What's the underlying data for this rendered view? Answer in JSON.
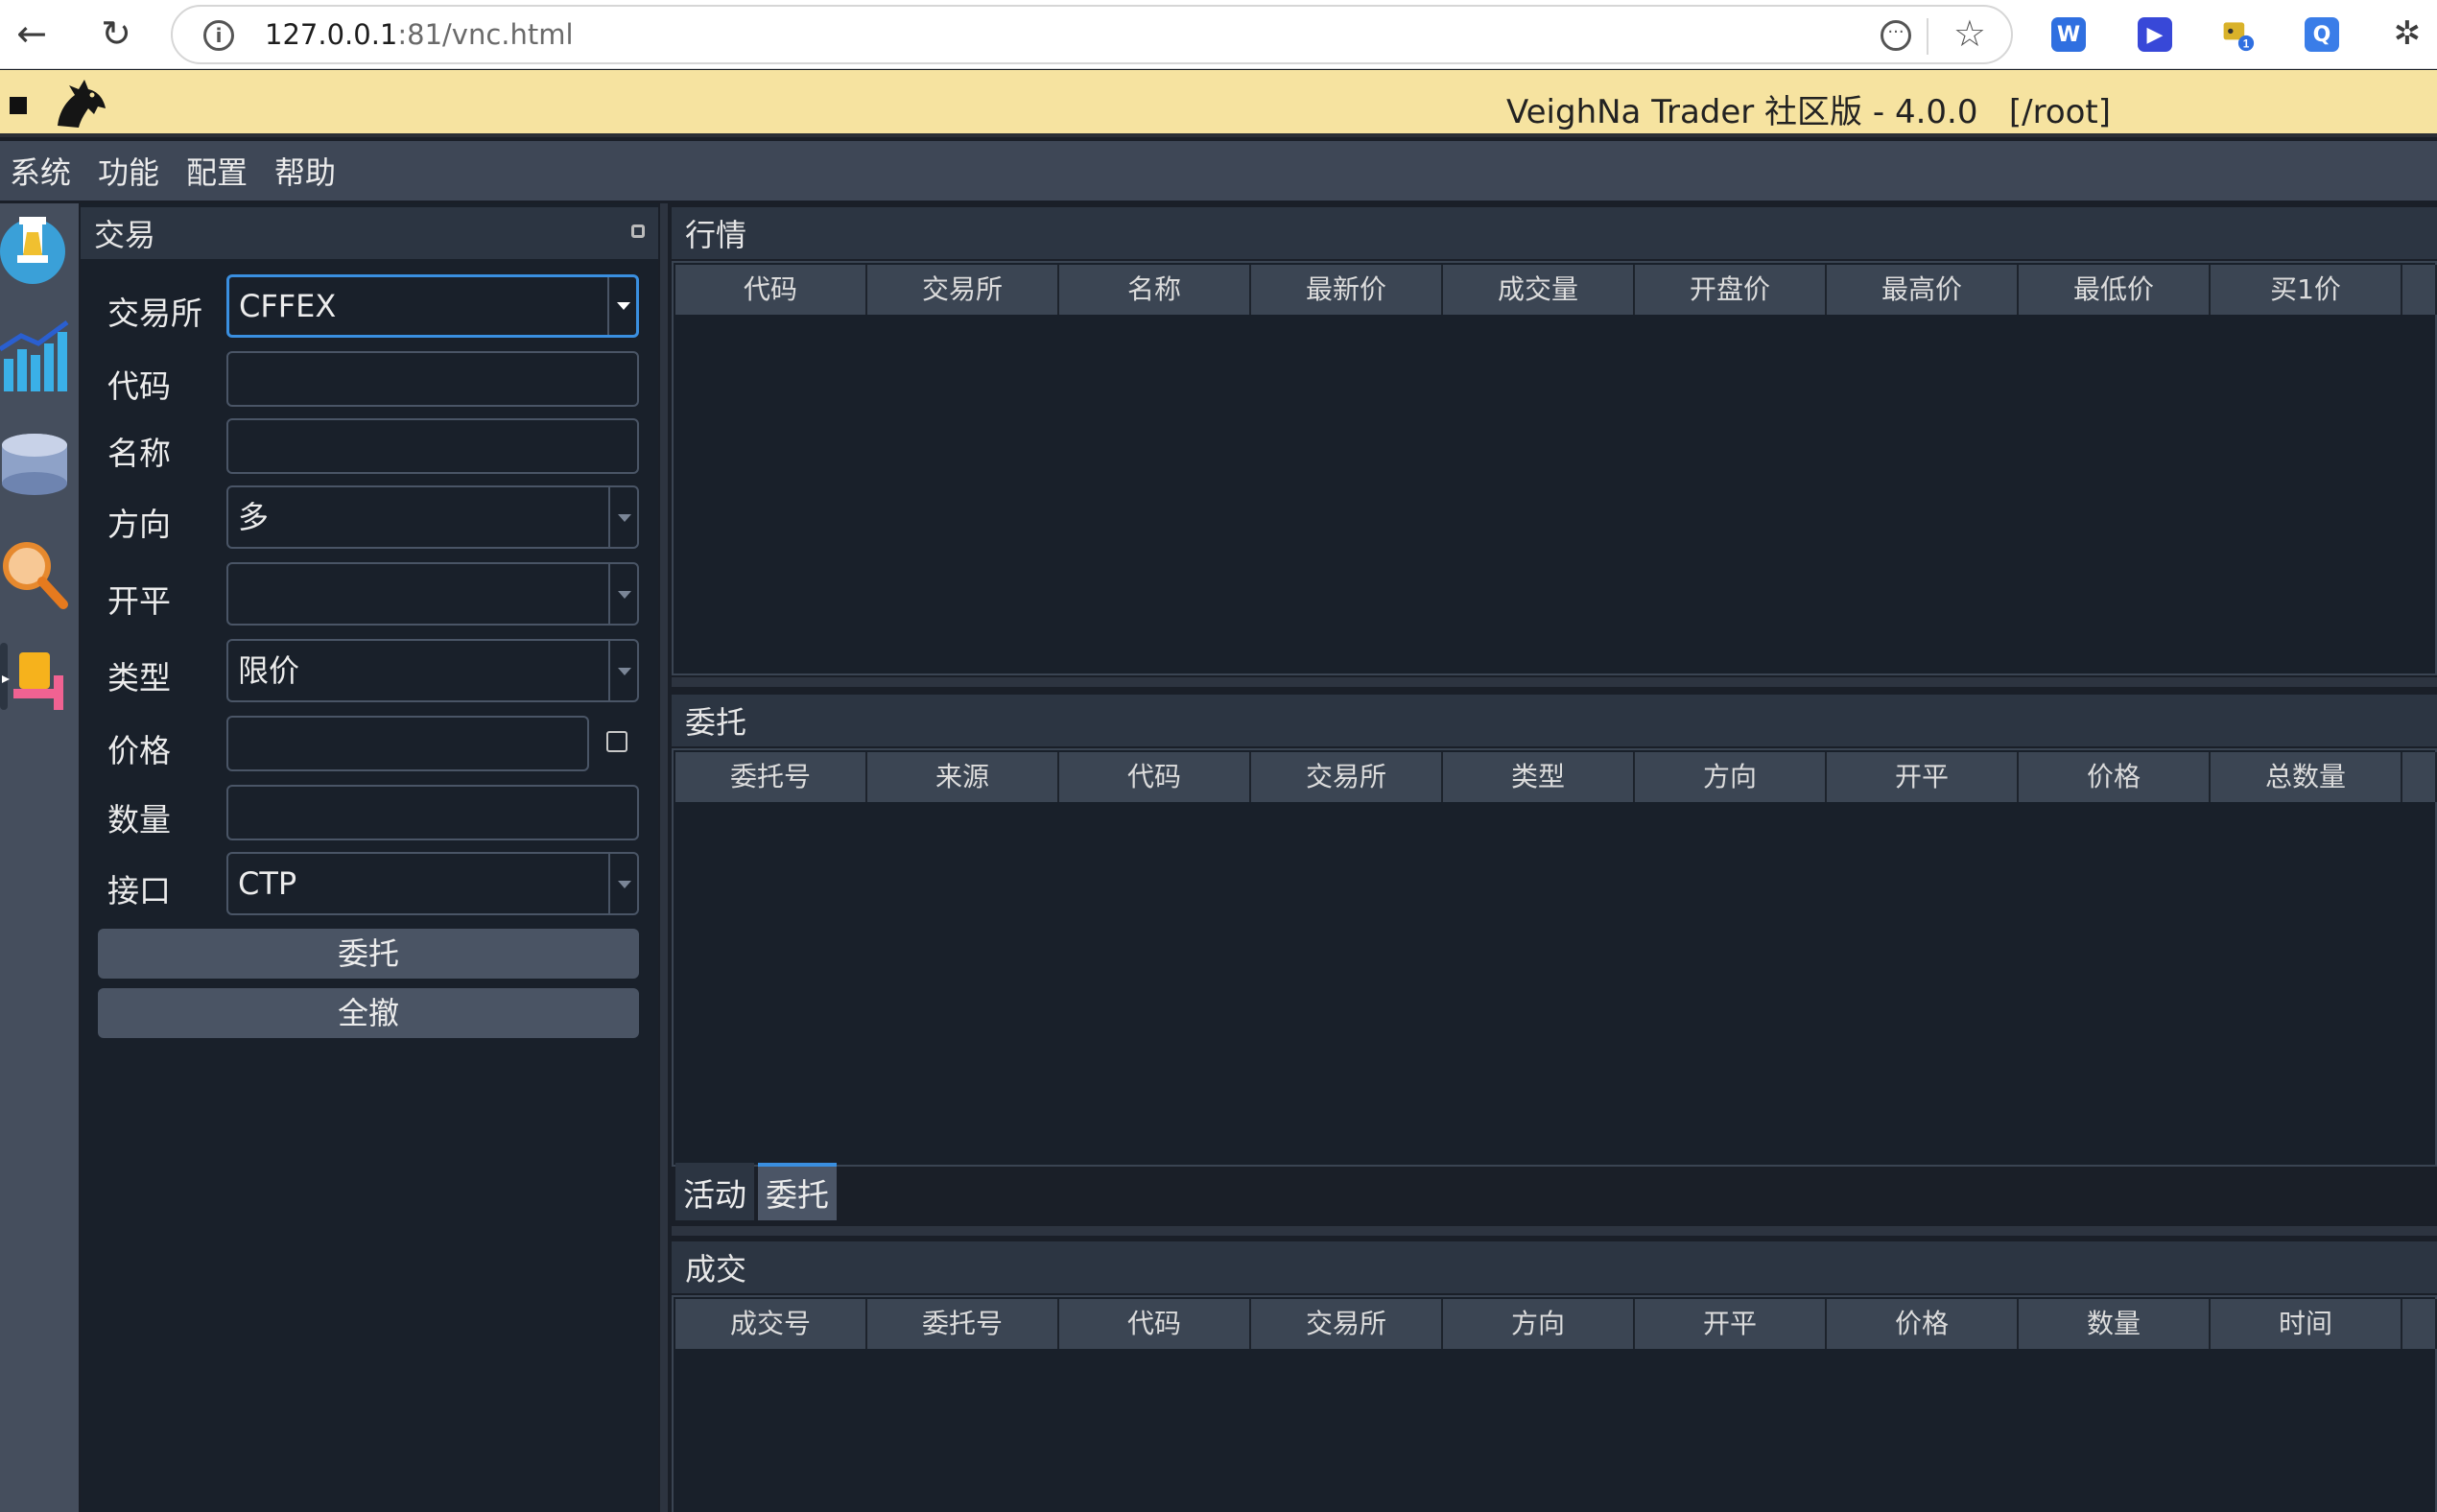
{
  "browser": {
    "url_host": "127.0.0.1",
    "url_rest": ":81/vnc.html",
    "extensions": [
      {
        "name": "word-extension-icon",
        "glyph": "W",
        "color": "#2f6fe0"
      },
      {
        "name": "play-extension-icon",
        "glyph": "▶",
        "color": "#3848d8"
      },
      {
        "name": "badge-extension-icon",
        "glyph": "",
        "color": "#c8a020",
        "badge": "1"
      },
      {
        "name": "profile-extension-icon",
        "glyph": "Q",
        "color": "#3a7de8"
      }
    ]
  },
  "app": {
    "title": "VeighNa Trader 社区版 - 4.0.0   [/root]"
  },
  "menu": [
    "系统",
    "功能",
    "配置",
    "帮助"
  ],
  "trade": {
    "title": "交易",
    "fields": {
      "exchange": {
        "label": "交易所",
        "value": "CFFEX"
      },
      "symbol": {
        "label": "代码",
        "value": ""
      },
      "name": {
        "label": "名称",
        "value": ""
      },
      "direction": {
        "label": "方向",
        "value": "多"
      },
      "offset": {
        "label": "开平",
        "value": ""
      },
      "type": {
        "label": "类型",
        "value": "限价"
      },
      "price": {
        "label": "价格",
        "value": ""
      },
      "volume": {
        "label": "数量",
        "value": ""
      },
      "gateway": {
        "label": "接口",
        "value": "CTP"
      }
    },
    "send_button": "委托",
    "cancel_all_button": "全撤"
  },
  "tick_panel": {
    "title": "行情",
    "columns": [
      "代码",
      "交易所",
      "名称",
      "最新价",
      "成交量",
      "开盘价",
      "最高价",
      "最低价",
      "买1价"
    ]
  },
  "order_panel": {
    "title": "委托",
    "columns": [
      "委托号",
      "来源",
      "代码",
      "交易所",
      "类型",
      "方向",
      "开平",
      "价格",
      "总数量"
    ],
    "tabs": [
      "活动",
      "委托"
    ],
    "active_tab": "委托"
  },
  "trade_panel": {
    "title": "成交",
    "columns": [
      "成交号",
      "委托号",
      "代码",
      "交易所",
      "方向",
      "开平",
      "价格",
      "数量",
      "时间"
    ]
  },
  "colors": {
    "title_bar": "#f6e3a0",
    "accent": "#3a8fe0",
    "background": "#19202a"
  }
}
